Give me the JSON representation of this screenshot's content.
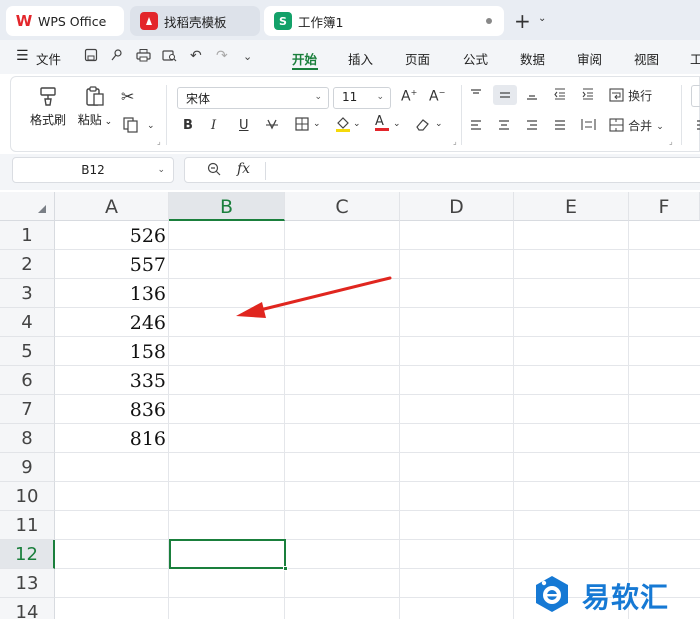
{
  "tabs": [
    {
      "label": "WPS Office",
      "icon": "wps-logo-icon"
    },
    {
      "label": "找稻壳模板",
      "icon": "daoke-logo-icon"
    },
    {
      "label": "工作簿1",
      "icon": "spreadsheet-logo-icon",
      "active": true
    }
  ],
  "tab_logos": {
    "wps": "W",
    "daoke": "",
    "sheet": "S"
  },
  "menubar": {
    "file": "文件",
    "items": [
      "开始",
      "插入",
      "页面",
      "公式",
      "数据",
      "审阅",
      "视图",
      "工"
    ],
    "active": "开始"
  },
  "ribbon": {
    "format_painter": "格式刷",
    "paste": "粘贴",
    "font_name": "宋体",
    "font_size": "11",
    "wrap_text": "换行",
    "merge": "合并",
    "bold": "B",
    "italic": "I",
    "underline": "U",
    "grow_font": "A",
    "shrink_font": "A",
    "font_color": "A"
  },
  "formula_bar": {
    "name_box": "B12",
    "fx": "fx",
    "content": ""
  },
  "grid": {
    "columns": [
      "A",
      "B",
      "C",
      "D",
      "E",
      "F"
    ],
    "selected_column": "B",
    "rows": [
      "1",
      "2",
      "3",
      "4",
      "5",
      "6",
      "7",
      "8",
      "9",
      "10",
      "11",
      "12",
      "13",
      "14"
    ],
    "selected_row": "12",
    "column_a_values": [
      "526",
      "557",
      "136",
      "246",
      "158",
      "335",
      "836",
      "816"
    ]
  },
  "accent_color": "#1a7f3c",
  "arrow_color": "#e0261f",
  "watermark": {
    "text": "易软汇"
  }
}
